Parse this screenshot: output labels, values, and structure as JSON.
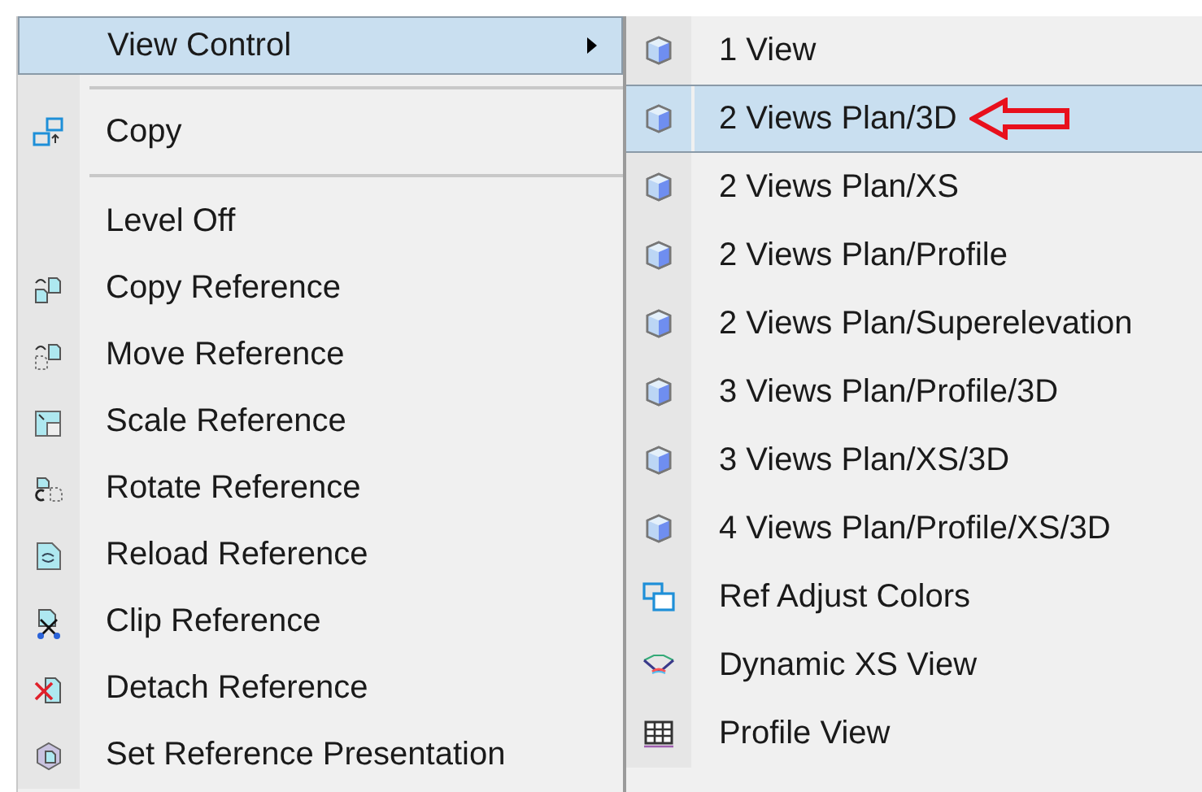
{
  "context_menu": {
    "items": [
      {
        "kind": "submenu",
        "label": "View Control",
        "selected": true
      },
      {
        "kind": "separator"
      },
      {
        "kind": "item",
        "label": "Copy",
        "selected": false
      },
      {
        "kind": "separator"
      },
      {
        "kind": "item",
        "label": "Level Off",
        "selected": false
      },
      {
        "kind": "item",
        "label": "Copy Reference",
        "selected": false
      },
      {
        "kind": "item",
        "label": "Move Reference",
        "selected": false
      },
      {
        "kind": "item",
        "label": "Scale Reference",
        "selected": false
      },
      {
        "kind": "item",
        "label": "Rotate Reference",
        "selected": false
      },
      {
        "kind": "item",
        "label": "Reload Reference",
        "selected": false
      },
      {
        "kind": "item",
        "label": "Clip Reference",
        "selected": false
      },
      {
        "kind": "item",
        "label": "Detach Reference",
        "selected": false
      },
      {
        "kind": "item",
        "label": "Set Reference Presentation",
        "selected": false
      }
    ]
  },
  "submenu": {
    "items": [
      {
        "label": "1 View",
        "selected": false
      },
      {
        "label": "2 Views Plan/3D",
        "selected": true
      },
      {
        "label": "2 Views Plan/XS",
        "selected": false
      },
      {
        "label": "2 Views Plan/Profile",
        "selected": false
      },
      {
        "label": "2 Views Plan/Superelevation",
        "selected": false
      },
      {
        "label": "3 Views Plan/Profile/3D",
        "selected": false
      },
      {
        "label": "3 Views Plan/XS/3D",
        "selected": false
      },
      {
        "label": "4 Views Plan/Profile/XS/3D",
        "selected": false
      },
      {
        "label": "Ref Adjust Colors",
        "selected": false
      },
      {
        "label": "Dynamic XS View",
        "selected": false
      },
      {
        "label": "Profile View",
        "selected": false
      }
    ]
  }
}
